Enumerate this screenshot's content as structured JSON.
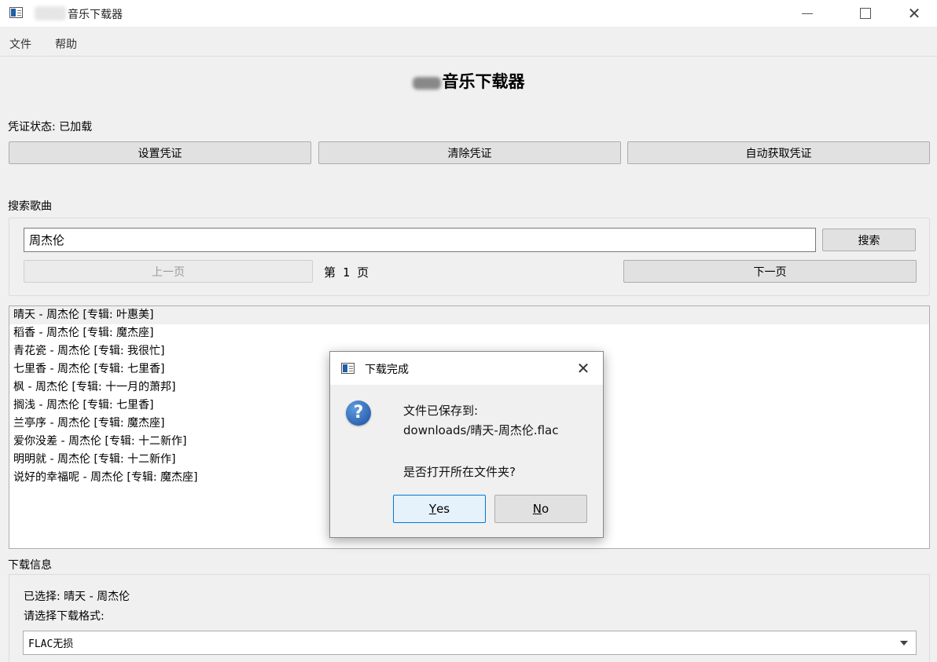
{
  "window": {
    "title": "音乐下载器"
  },
  "menu": {
    "file": "文件",
    "help": "帮助"
  },
  "header": {
    "title": "音乐下载器"
  },
  "credentials": {
    "status_label": "凭证状态: 已加载",
    "set_button": "设置凭证",
    "clear_button": "清除凭证",
    "auto_button": "自动获取凭证"
  },
  "search": {
    "section_label": "搜索歌曲",
    "query": "周杰伦",
    "search_button": "搜索",
    "prev_button": "上一页",
    "page_label": "第 1 页",
    "next_button": "下一页"
  },
  "results": [
    "晴天 - 周杰伦 [专辑: 叶惠美]",
    "稻香 - 周杰伦 [专辑: 魔杰座]",
    "青花瓷 - 周杰伦 [专辑: 我很忙]",
    "七里香 - 周杰伦 [专辑: 七里香]",
    "枫 - 周杰伦 [专辑: 十一月的萧邦]",
    "搁浅 - 周杰伦 [专辑: 七里香]",
    "兰亭序 - 周杰伦 [专辑: 魔杰座]",
    "爱你没差 - 周杰伦 [专辑: 十二新作]",
    "明明就 - 周杰伦 [专辑: 十二新作]",
    "说好的幸福呢 - 周杰伦 [专辑: 魔杰座]"
  ],
  "download": {
    "section_label": "下载信息",
    "selected": "已选择: 晴天 - 周杰伦",
    "format_prompt": "请选择下载格式:",
    "format_value": "FLAC无损"
  },
  "dialog": {
    "title": "下载完成",
    "line1": "文件已保存到:",
    "line2": "downloads/晴天-周杰伦.flac",
    "question": "是否打开所在文件夹?",
    "yes_mnemonic": "Y",
    "yes_rest": "es",
    "no_mnemonic": "N",
    "no_rest": "o"
  }
}
